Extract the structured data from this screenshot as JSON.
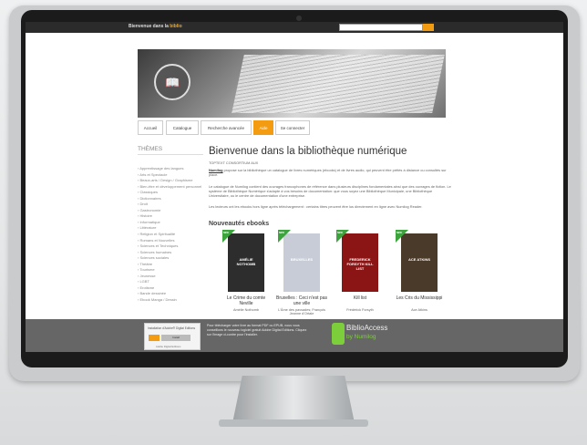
{
  "topbar": {
    "welcome_prefix": "Bienvenue dans la",
    "welcome_highlight": "biblio",
    "search_button": "ok"
  },
  "nav": {
    "items": [
      {
        "label": "Accueil"
      },
      {
        "label": "Catalogue"
      },
      {
        "label": "Recherche avancée"
      },
      {
        "label": "Aide"
      },
      {
        "label": "Se connecter"
      }
    ]
  },
  "sidebar": {
    "title": "THÈMES",
    "items": [
      "Apprentissage des langues",
      "Arts et Spectacle",
      "Beaux-arts / Design / Graphisme",
      "Bien-être et développement personnel",
      "Classiques",
      "Dictionnaires",
      "Droit",
      "Gastronomie",
      "Histoire",
      "Informatique",
      "Littérature",
      "Religion et Spiritualité",
      "Romans et Nouvelles",
      "Sciences et Techniques",
      "Sciences humaines",
      "Sciences sociales",
      "Théâtre",
      "Tourisme",
      "Jeunesse",
      "LGBT",
      "Erotisme",
      "Bande dessinée",
      "Ebook Manga / Dessin"
    ]
  },
  "main": {
    "title": "Bienvenue dans la bibliothèque numérique",
    "intro_label": "TOPTEXT CONSORTIUM AUX",
    "para1_brand": "Numilog",
    "para1_rest": " propose sur la bibliothèque un catalogue de livres numériques (ebooks) et de livres audio, qui peuvent être prêtés à distance ou consultés sur place.",
    "para2": "Le catalogue de Numilog contient des ouvrages francophones de référence dans plusieurs disciplines fondamentales ainsi que des ouvrages de fiction. Le système de Bibliothèque Numérique s'adapte à vos besoins de documentation: que vous soyez une Bibliothèque Municipale, une Bibliothèque Universitaire, ou le centre de documentation d'une entreprise.",
    "para3": "Les lecteurs ont les ebooks hors ligne après téléchargement : certains titres peuvent être lus directement en ligne avec Numilog Reader.",
    "ebooks_title": "Nouveautés ebooks"
  },
  "books": [
    {
      "title": "Le Crime du comte Neville",
      "author": "Amélie Nothomb",
      "ribbon": "NEW",
      "cover_text": "AMÉLIE NOTHOMB",
      "cover_bg": "#2d2d2d"
    },
    {
      "title": "Bruxelles : Ceci n'est pas une ville",
      "author": "L'Âme des pavsades; François Jeanne d'Ortale",
      "ribbon": "NEW",
      "cover_text": "BRUXELLES",
      "cover_bg": "#c7ccd6"
    },
    {
      "title": "Kill list",
      "author": "Frédérick Forsyth",
      "ribbon": "NEW",
      "cover_text": "FREDERICK FORSYTH KILL LIST",
      "cover_bg": "#8b1414"
    },
    {
      "title": "Les Cris du Mississippi",
      "author": "Ace Atkins",
      "ribbon": "NEW",
      "cover_text": "ACE ATKINS",
      "cover_bg": "#4a3a2a"
    }
  ],
  "footer": {
    "box_title": "Installation d'Adobe® Digital Editions",
    "box_button": "Install",
    "box_note": "Adobe Digital Editions",
    "text": "Pour télécharger votre livre au format PDF ou EPUB, nous vous conseillons le nouveau logiciel gratuit Adobe Digital Editions. Cliquez sur l'image ci-contre pour l'installer.",
    "brand_name": "BiblioAccess",
    "brand_by": "by Numilog"
  },
  "colors": {
    "accent": "#f39c12",
    "ribbon": "#3da33d",
    "footer": "#666666",
    "brand_green": "#7ccf3a"
  }
}
